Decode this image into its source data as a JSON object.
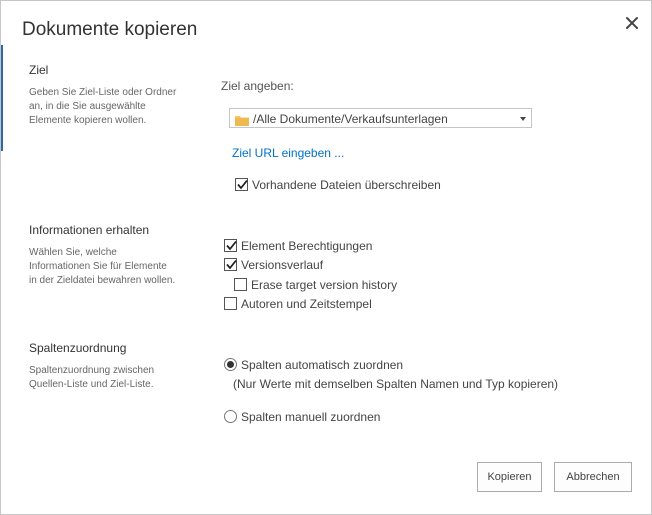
{
  "dialog": {
    "title": "Dokumente kopieren",
    "close_icon": "close-icon"
  },
  "ziel": {
    "title": "Ziel",
    "description": [
      "Geben Sie Ziel-Liste oder Ordner",
      "an, in die Sie ausgewählte",
      "Elemente kopieren wollen."
    ],
    "prompt": "Ziel angeben:",
    "select_value": "/Alle Dokumente/Verkaufsunterlagen",
    "folder_icon": "folder-icon",
    "dropdown_icon": "chevron-down-icon",
    "url_link": "Ziel URL eingeben ...",
    "overwrite_label": "Vorhandene Dateien überschreiben",
    "overwrite_checked": true
  },
  "info": {
    "title": "Informationen erhalten",
    "description": [
      "Wählen Sie, welche",
      "Informationen Sie für Elemente",
      "in der Zieldatei bewahren wollen."
    ],
    "options": [
      {
        "label": "Element Berechtigungen",
        "checked": true
      },
      {
        "label": "Versionsverlauf",
        "checked": true
      },
      {
        "label": "Erase target version history",
        "checked": false
      },
      {
        "label": "Autoren und Zeitstempel",
        "checked": false
      }
    ]
  },
  "mapping": {
    "title": "Spaltenzuordnung",
    "description": [
      "Spaltenzuordnung zwischen",
      "Quellen-Liste und Ziel-Liste."
    ],
    "auto_label": "Spalten automatisch zuordnen",
    "auto_note": "(Nur Werte mit demselben Spalten Namen und Typ kopieren)",
    "manual_label": "Spalten manuell zuordnen",
    "selected": "auto"
  },
  "buttons": {
    "copy": "Kopieren",
    "cancel": "Abbrechen"
  },
  "colors": {
    "link": "#0072c6",
    "accent": "#2a6aa8",
    "folder": "#f5c76a"
  }
}
